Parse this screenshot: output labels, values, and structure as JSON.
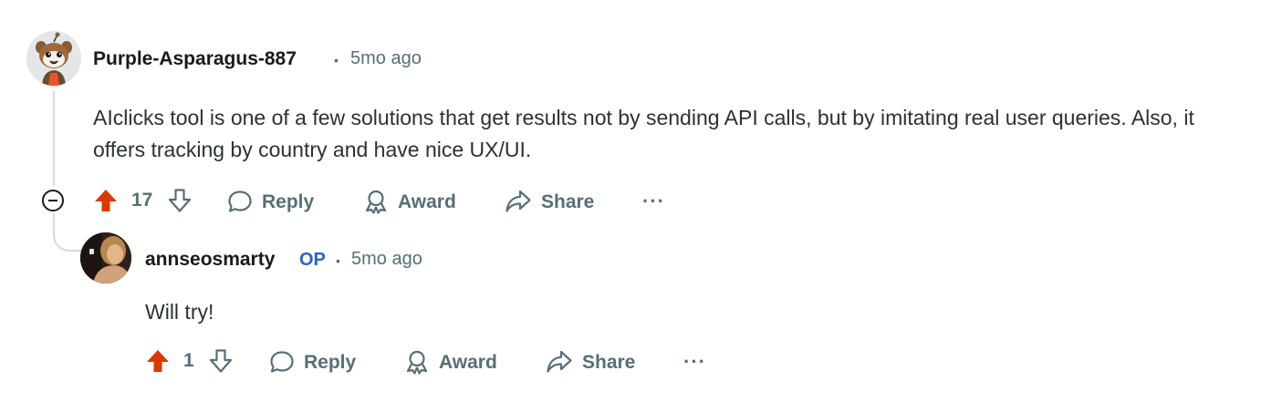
{
  "comments": [
    {
      "author": "Purple-Asparagus-887",
      "separator": "•",
      "time": "5mo ago",
      "text": "AIclicks tool is one of a few solutions that get results not by sending API calls, but by imitating real user queries. Also, it offers tracking by country and have nice UX/UI.",
      "votes": "17",
      "actions": {
        "reply": "Reply",
        "award": "Award",
        "share": "Share",
        "more": "···"
      },
      "upvoted": true,
      "avatar_icon": "snoo-avatar-icon"
    },
    {
      "author": "annseosmarty",
      "op_badge": "OP",
      "separator": "•",
      "time": "5mo ago",
      "text": "Will try!",
      "votes": "1",
      "actions": {
        "reply": "Reply",
        "award": "Award",
        "share": "Share",
        "more": "···"
      },
      "upvoted": true,
      "avatar_icon": "user-photo-avatar"
    }
  ],
  "colors": {
    "upvote": "#d93a00",
    "muted": "#576f76",
    "op": "#2f61c7",
    "thread": "#d7dadc"
  }
}
